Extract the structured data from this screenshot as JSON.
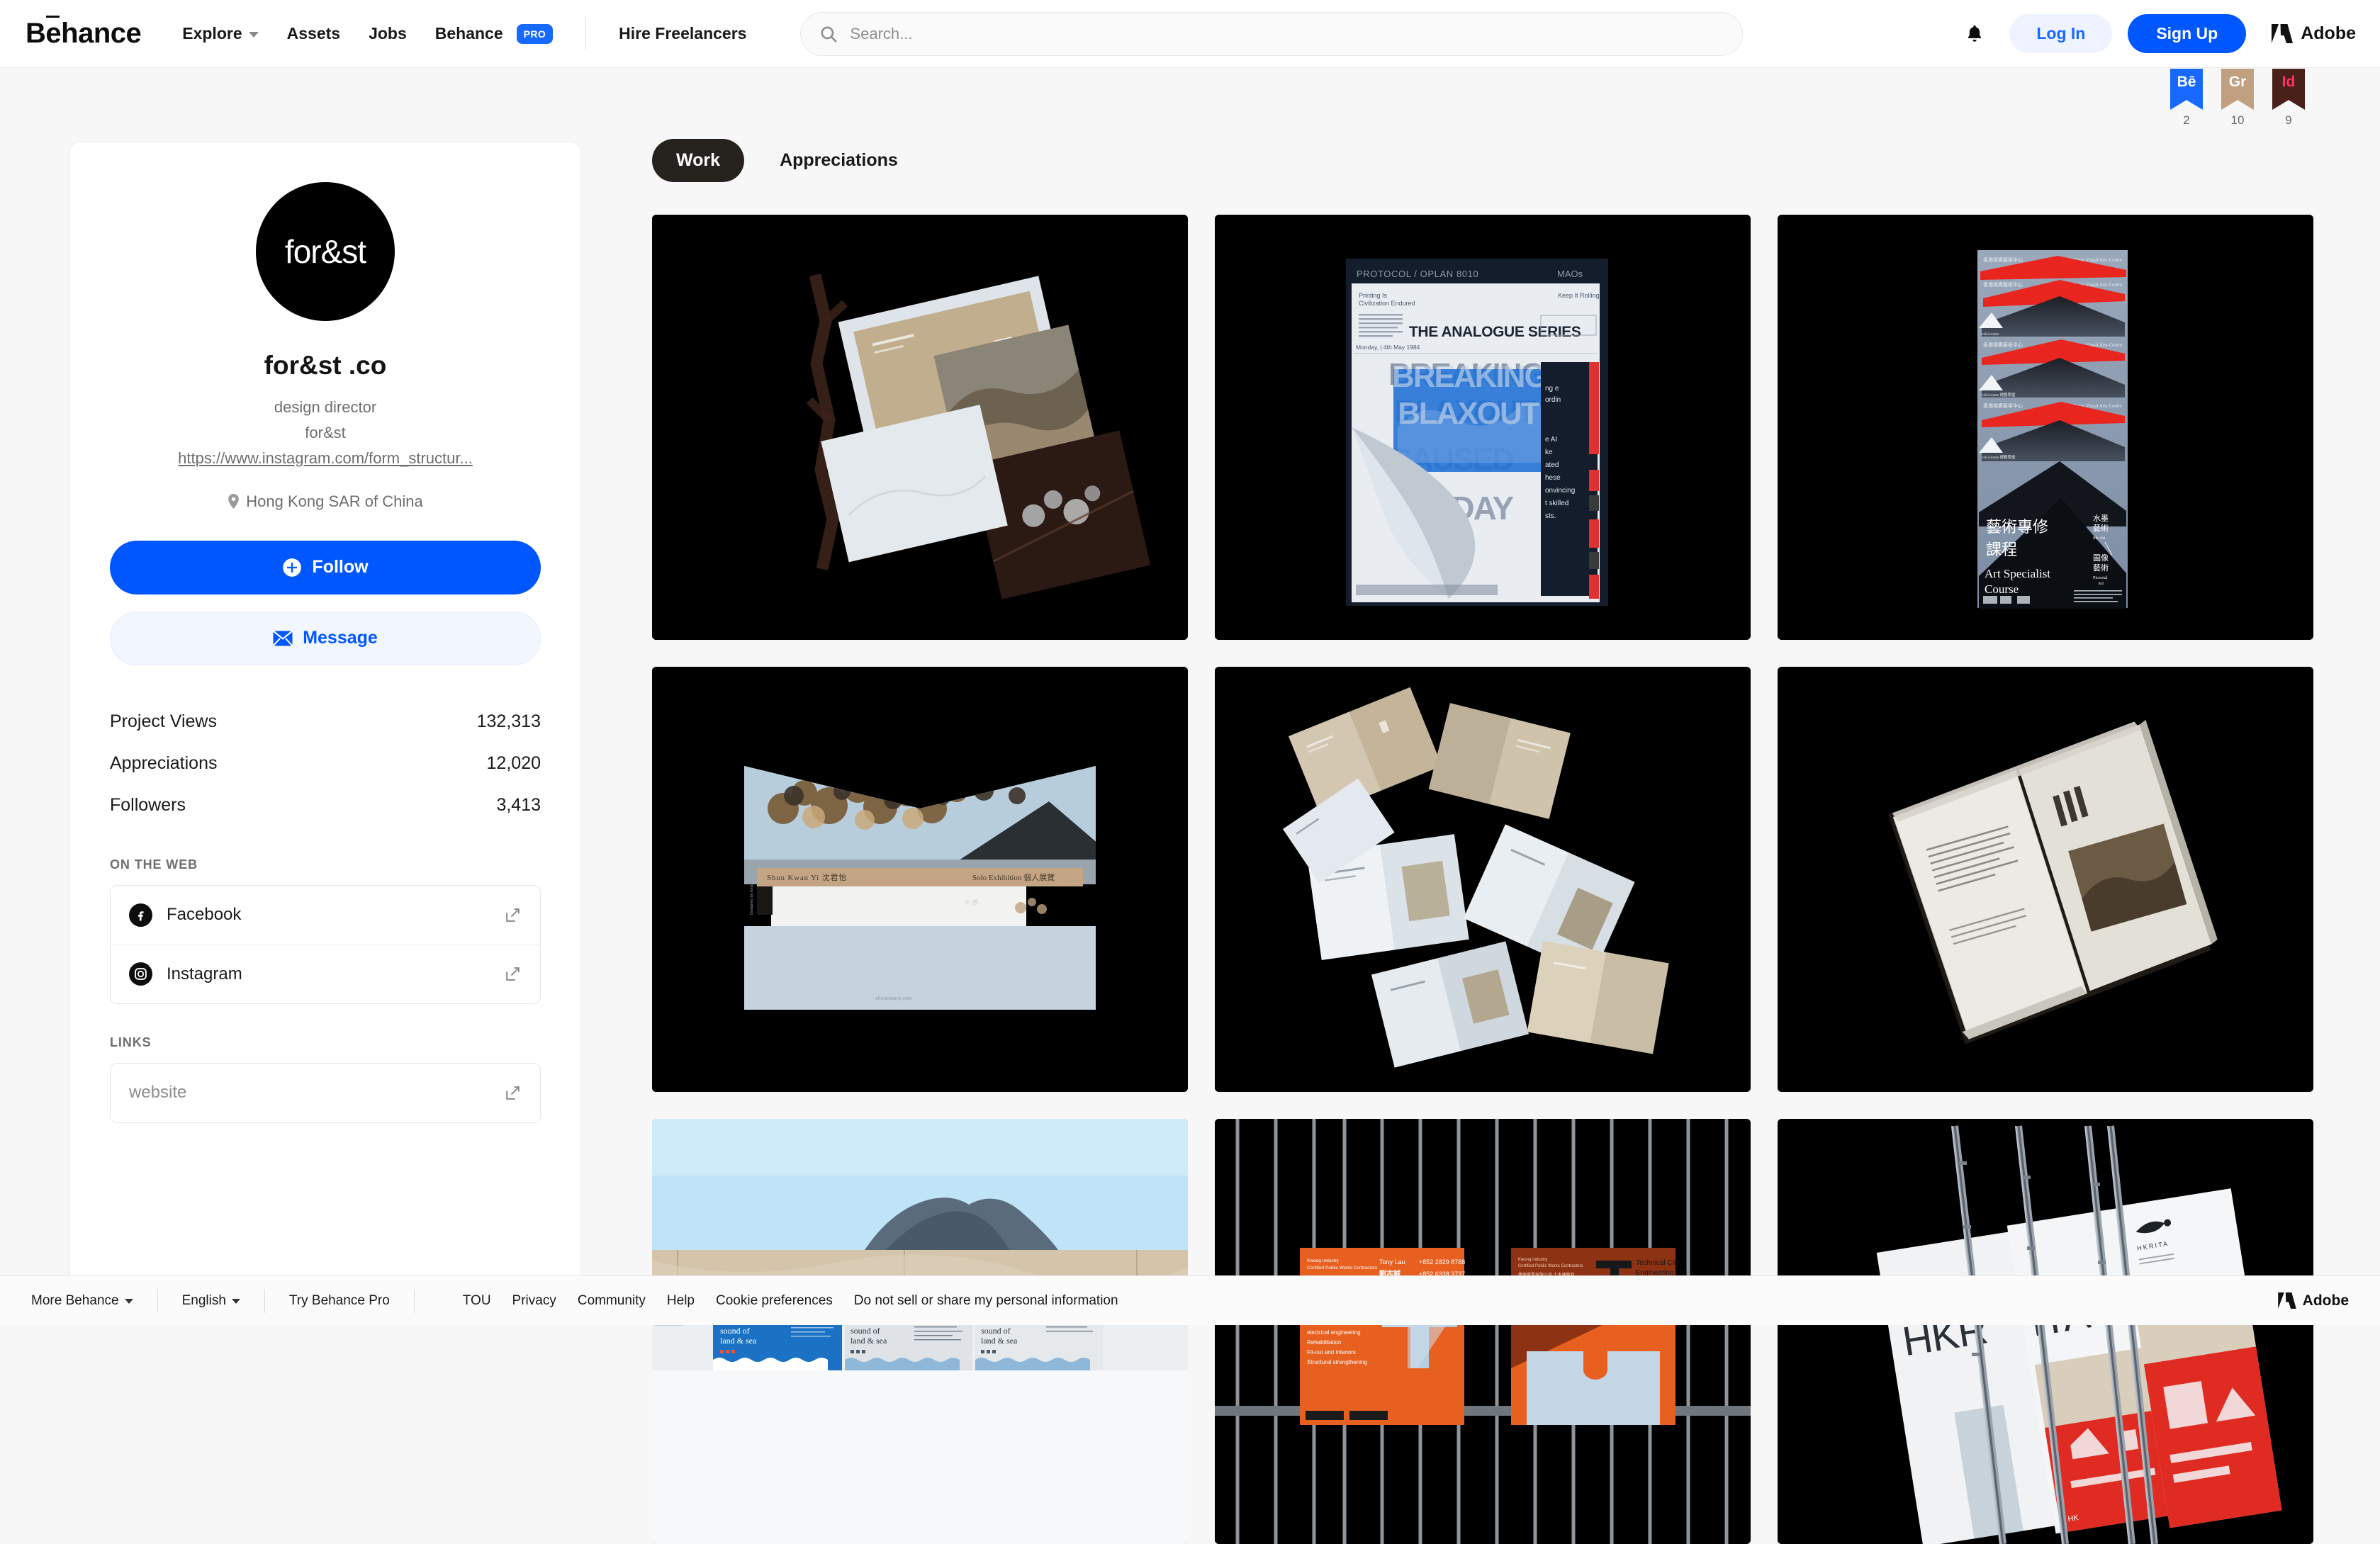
{
  "nav": {
    "brand": "Bēhance",
    "items": [
      {
        "label": "Explore",
        "icon": "chevron-down-icon",
        "has_chevron": true
      },
      {
        "label": "Assets",
        "has_chevron": false
      },
      {
        "label": "Jobs",
        "has_chevron": false
      },
      {
        "label": "Behance",
        "badge": "PRO",
        "has_chevron": false
      }
    ],
    "hire_label": "Hire Freelancers",
    "search_placeholder": "Search...",
    "search_icon": "search-icon",
    "bell_icon": "bell-icon",
    "login_label": "Log In",
    "signup_label": "Sign Up",
    "adobe_label": "Adobe"
  },
  "ribbons": [
    {
      "mark": "Bē",
      "count": "2",
      "color": "#1769ff",
      "text_color": "#ffffff"
    },
    {
      "mark": "Gr",
      "count": "10",
      "color": "#c0a080",
      "text_color": "#ffffff"
    },
    {
      "mark": "Id",
      "count": "9",
      "color": "#49211a",
      "text_color": "#ff3366"
    }
  ],
  "profile": {
    "avatar_text": "for&st",
    "name": "for&st .co",
    "role": "design director",
    "company": "for&st",
    "website_link": "https://www.instagram.com/form_structur...",
    "location": "Hong Kong SAR of China",
    "location_icon": "map-pin-icon",
    "follow_label": "Follow",
    "follow_icon": "plus-circle-icon",
    "message_label": "Message",
    "message_icon": "envelope-icon",
    "stats": [
      {
        "label": "Project Views",
        "value": "132,313"
      },
      {
        "label": "Appreciations",
        "value": "12,020"
      },
      {
        "label": "Followers",
        "value": "3,413"
      }
    ],
    "on_the_web_label": "ON THE WEB",
    "social": [
      {
        "label": "Facebook",
        "icon": "facebook-icon",
        "external_icon": "external-link-icon"
      },
      {
        "label": "Instagram",
        "icon": "instagram-icon",
        "external_icon": "external-link-icon"
      }
    ],
    "links_label": "LINKS",
    "links": [
      {
        "placeholder": "website",
        "external_icon": "external-link-icon"
      }
    ]
  },
  "main": {
    "tabs": [
      {
        "label": "Work",
        "active": true
      },
      {
        "label": "Appreciations",
        "active": false
      }
    ],
    "projects": [
      {
        "name": "folder-with-printed-inserts",
        "kind": "photo-dark"
      },
      {
        "name": "the-analogue-series-newspaper",
        "kind": "newspaper"
      },
      {
        "name": "art-specialist-course-posters",
        "kind": "poster-stack"
      },
      {
        "name": "shun-kwan-yi-solo-exhibition-envelope",
        "kind": "envelope"
      },
      {
        "name": "scattered-folded-brochures",
        "kind": "scatter"
      },
      {
        "name": "open-book-spread",
        "kind": "book"
      },
      {
        "name": "hear-the-sound-of-land-and-sea-hoarding",
        "kind": "hoarding"
      },
      {
        "name": "technical-city-engineering-cards",
        "kind": "orange-cards"
      },
      {
        "name": "hkrita-posters",
        "kind": "hkrita"
      }
    ]
  },
  "footer": {
    "more_behance": "More Behance",
    "language": "English",
    "try_pro": "Try Behance Pro",
    "links": [
      "TOU",
      "Privacy",
      "Community",
      "Help",
      "Cookie preferences",
      "Do not sell or share my personal information"
    ],
    "adobe_label": "Adobe"
  }
}
